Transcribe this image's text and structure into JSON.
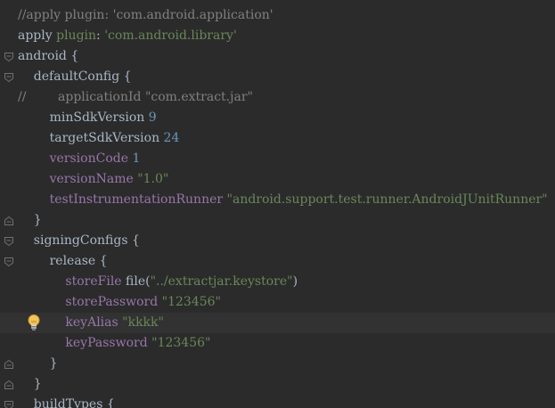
{
  "editor": {
    "lines": [
      {
        "tokens": [
          {
            "t": "//apply plugin: 'com.android.application'",
            "c": "comment"
          }
        ]
      },
      {
        "tokens": [
          {
            "t": "apply ",
            "c": "plain"
          },
          {
            "t": "plugin",
            "c": "string"
          },
          {
            "t": ": ",
            "c": "plain"
          },
          {
            "t": "'com.android.library'",
            "c": "string"
          }
        ]
      },
      {
        "tokens": [
          {
            "t": "android {",
            "c": "plain"
          }
        ]
      },
      {
        "tokens": [
          {
            "t": "    defaultConfig {",
            "c": "plain"
          }
        ]
      },
      {
        "tokens": [
          {
            "t": "//        applicationId \"com.extract.jar\"",
            "c": "comment"
          }
        ]
      },
      {
        "tokens": [
          {
            "t": "        minSdkVersion ",
            "c": "plain"
          },
          {
            "t": "9",
            "c": "number"
          }
        ]
      },
      {
        "tokens": [
          {
            "t": "        targetSdkVersion ",
            "c": "plain"
          },
          {
            "t": "24",
            "c": "number"
          }
        ]
      },
      {
        "tokens": [
          {
            "t": "        ",
            "c": "plain"
          },
          {
            "t": "versionCode",
            "c": "ident"
          },
          {
            "t": " ",
            "c": "plain"
          },
          {
            "t": "1",
            "c": "number"
          }
        ]
      },
      {
        "tokens": [
          {
            "t": "        ",
            "c": "plain"
          },
          {
            "t": "versionName",
            "c": "ident"
          },
          {
            "t": " ",
            "c": "plain"
          },
          {
            "t": "\"1.0\"",
            "c": "string"
          }
        ]
      },
      {
        "tokens": [
          {
            "t": "        ",
            "c": "plain"
          },
          {
            "t": "testInstrumentationRunner",
            "c": "ident"
          },
          {
            "t": " ",
            "c": "plain"
          },
          {
            "t": "\"android.support.test.runner.AndroidJUnitRunner\"",
            "c": "string"
          }
        ]
      },
      {
        "tokens": [
          {
            "t": "    }",
            "c": "plain"
          }
        ]
      },
      {
        "tokens": [
          {
            "t": "    signingConfigs {",
            "c": "plain"
          }
        ]
      },
      {
        "tokens": [
          {
            "t": "        release {",
            "c": "plain"
          }
        ]
      },
      {
        "tokens": [
          {
            "t": "            ",
            "c": "plain"
          },
          {
            "t": "storeFile",
            "c": "ident"
          },
          {
            "t": " file(",
            "c": "plain"
          },
          {
            "t": "\"../extractjar.keystore\"",
            "c": "string"
          },
          {
            "t": ")",
            "c": "plain"
          }
        ]
      },
      {
        "tokens": [
          {
            "t": "            ",
            "c": "plain"
          },
          {
            "t": "storePassword",
            "c": "ident"
          },
          {
            "t": " ",
            "c": "plain"
          },
          {
            "t": "\"123456\"",
            "c": "string"
          }
        ]
      },
      {
        "tokens": [
          {
            "t": "            ",
            "c": "plain"
          },
          {
            "t": "keyAlias",
            "c": "ident"
          },
          {
            "t": " ",
            "c": "plain"
          },
          {
            "t": "\"kkkk\"",
            "c": "string"
          }
        ],
        "current": true
      },
      {
        "tokens": [
          {
            "t": "            ",
            "c": "plain"
          },
          {
            "t": "keyPassword",
            "c": "ident"
          },
          {
            "t": " ",
            "c": "plain"
          },
          {
            "t": "\"123456\"",
            "c": "string"
          }
        ]
      },
      {
        "tokens": [
          {
            "t": "        }",
            "c": "plain"
          }
        ]
      },
      {
        "tokens": [
          {
            "t": "    }",
            "c": "plain"
          }
        ]
      },
      {
        "tokens": [
          {
            "t": "    buildTypes {",
            "c": "plain"
          }
        ]
      }
    ],
    "fold_markers": [
      {
        "line": 2,
        "kind": "open",
        "icon": "fold-open-icon"
      },
      {
        "line": 3,
        "kind": "open",
        "icon": "fold-open-icon"
      },
      {
        "line": 10,
        "kind": "close",
        "icon": "fold-close-icon"
      },
      {
        "line": 11,
        "kind": "open",
        "icon": "fold-open-icon"
      },
      {
        "line": 12,
        "kind": "open",
        "icon": "fold-open-icon"
      },
      {
        "line": 17,
        "kind": "close",
        "icon": "fold-close-icon"
      },
      {
        "line": 18,
        "kind": "close",
        "icon": "fold-close-icon"
      },
      {
        "line": 19,
        "kind": "open",
        "icon": "fold-open-icon"
      }
    ],
    "intention_bulb": {
      "line": 15,
      "icon": "lightbulb-icon"
    },
    "colors": {
      "background": "#2b2b2b",
      "current_line": "#323232",
      "plain": "#a9b7c6",
      "comment": "#808080",
      "string": "#6a8759",
      "ident": "#9876aa",
      "number": "#6897bb"
    }
  }
}
